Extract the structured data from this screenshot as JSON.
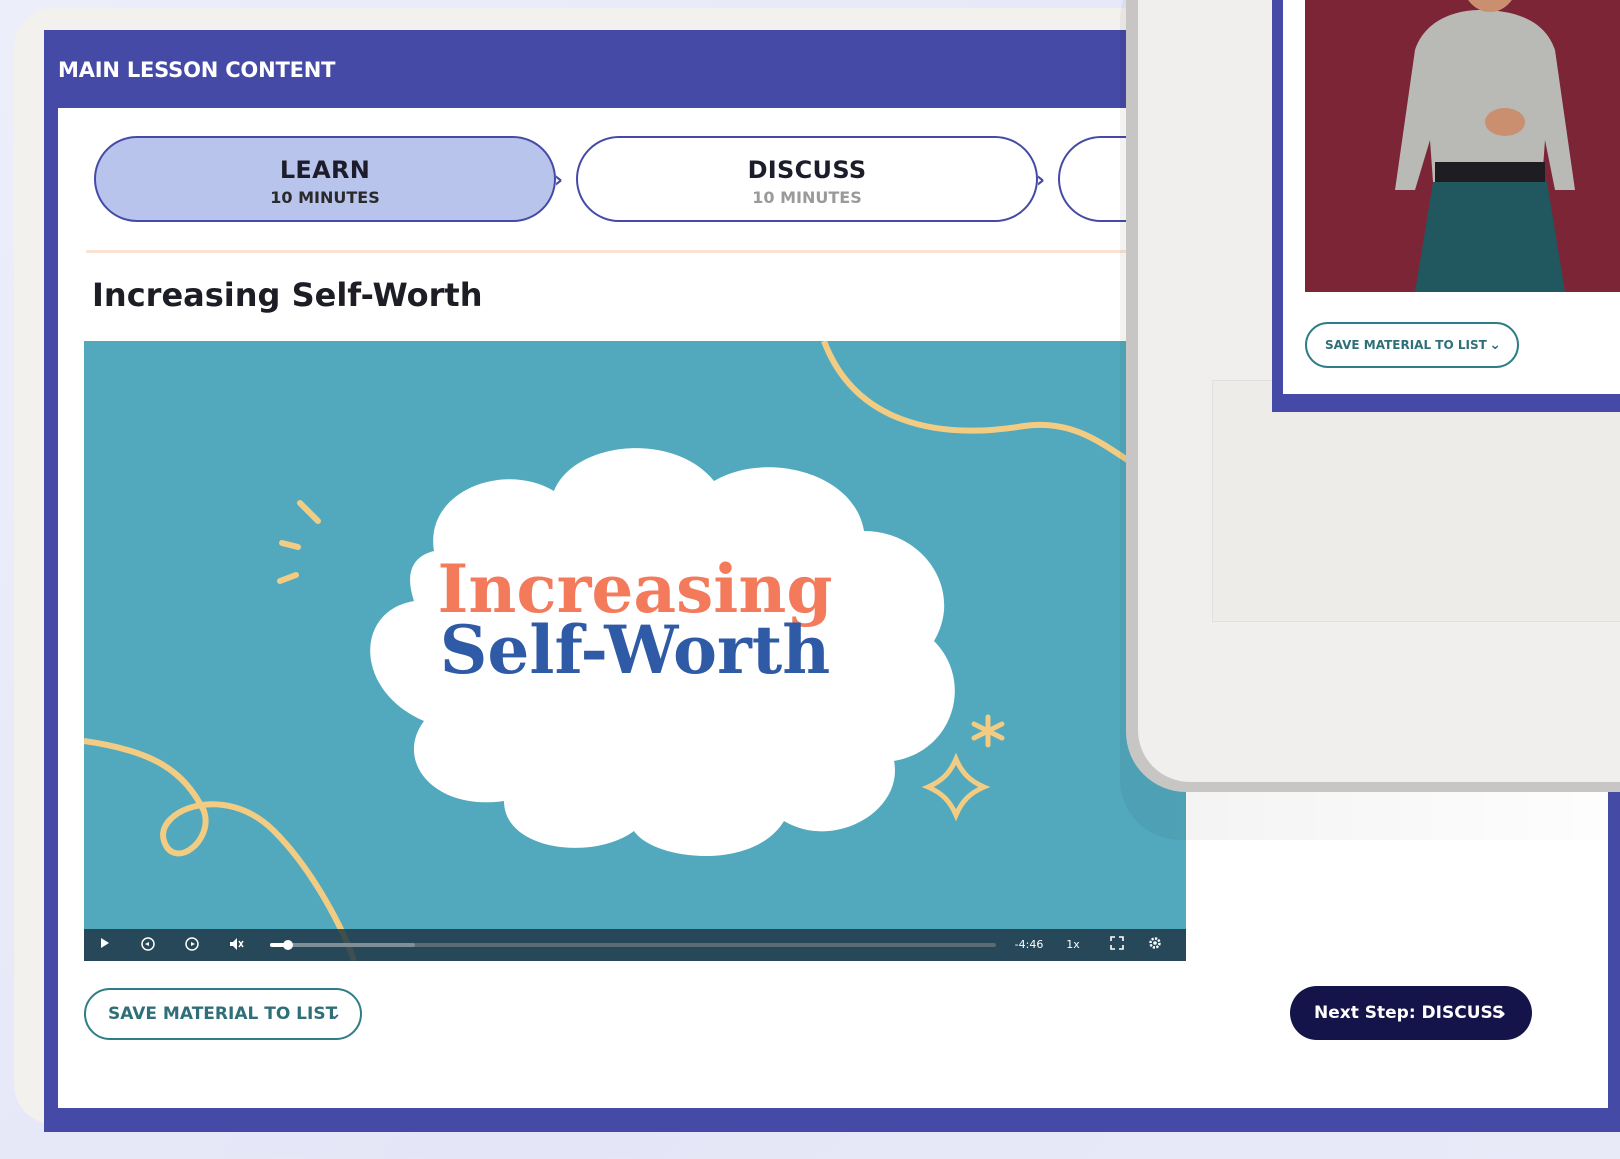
{
  "lesson": {
    "header": "MAIN LESSON CONTENT",
    "title": "Increasing Self-Worth",
    "steps": [
      {
        "title": "LEARN",
        "duration": "10 MINUTES",
        "active": true
      },
      {
        "title": "DISCUSS",
        "duration": "10 MINUTES",
        "active": false
      }
    ],
    "step_chevron": "›"
  },
  "video": {
    "title_line1": "Increasing",
    "title_line2": "Self-Worth",
    "time_remaining": "-4:46",
    "speed": "1x",
    "progress": 0.025,
    "buffered": 0.2,
    "controls": [
      "play-icon",
      "rewind-icon",
      "forward-icon",
      "mute-icon",
      "fullscreen-icon",
      "settings-icon"
    ]
  },
  "actions": {
    "save_material": "SAVE MATERIAL TO LIST",
    "next_step": "Next Step: DISCUSS"
  },
  "overlay": {
    "save_material": "SAVE MATERIAL TO LIST"
  },
  "colors": {
    "brand_purple": "#454aa6",
    "active_step": "#b8c4ec",
    "teal": "#2f7d86",
    "navy_button": "#14144a",
    "video_bg": "#52a9bd",
    "title_orange": "#f47a5c",
    "title_blue": "#2f5aa5"
  }
}
